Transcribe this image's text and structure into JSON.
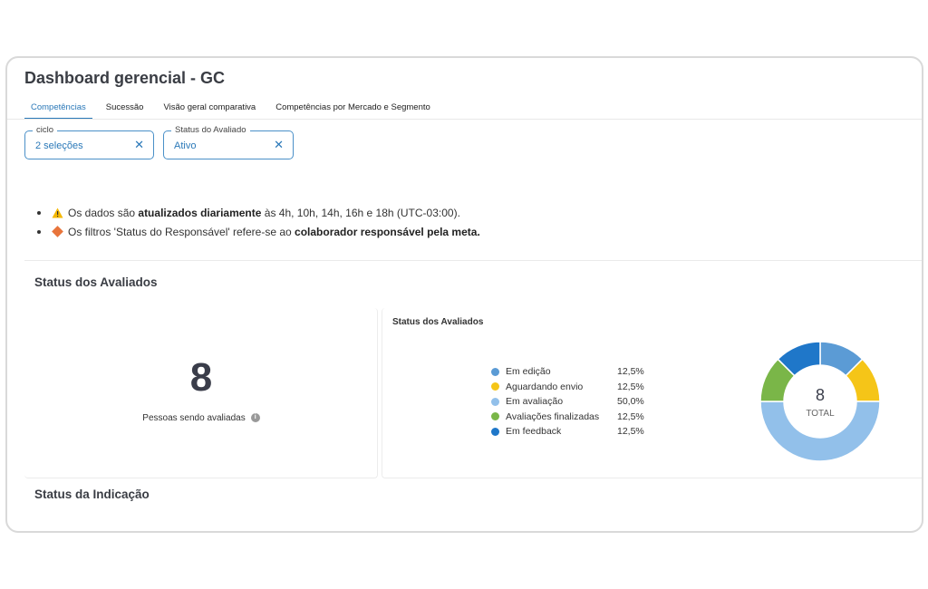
{
  "app": {
    "title": "Dashboard gerencial - GC"
  },
  "tabs": [
    {
      "label": "Competências",
      "active": true
    },
    {
      "label": "Sucessão",
      "active": false
    },
    {
      "label": "Visão geral comparativa",
      "active": false
    },
    {
      "label": "Competências por Mercado e Segmento",
      "active": false
    }
  ],
  "filters": [
    {
      "label": "ciclo",
      "value": "2 seleções",
      "clear_icon": "close-icon"
    },
    {
      "label": "Status do Avaliado",
      "value": "Ativo",
      "clear_icon": "close-icon"
    }
  ],
  "notices": [
    {
      "icon": "warning-icon",
      "parts": [
        {
          "text": "Os dados são ",
          "bold": false
        },
        {
          "text": "atualizados diariamente",
          "bold": true
        },
        {
          "text": " às 4h, 10h, 14h, 16h e 18h (UTC-03:00).",
          "bold": false
        }
      ]
    },
    {
      "icon": "diamond-icon",
      "parts": [
        {
          "text": "Os filtros 'Status do Responsável' refere-se ao ",
          "bold": false
        },
        {
          "text": "colaborador responsável pela meta.",
          "bold": true
        }
      ]
    }
  ],
  "sections": {
    "status_avaliados": "Status dos Avaliados",
    "status_indicacao": "Status da Indicação"
  },
  "kpi": {
    "value": "8",
    "label": "Pessoas sendo avaliadas",
    "info_icon": "info-icon"
  },
  "donut_chart": {
    "title": "Status dos Avaliados",
    "total_value": "8",
    "total_label": "TOTAL",
    "colors": {
      "Em edição": "#5b9bd5",
      "Aguardando envio": "#f5c518",
      "Em avaliação": "#92c0ea",
      "Avaliações finalizadas": "#7ab648",
      "Em feedback": "#1f77c9"
    }
  },
  "chart_data": {
    "type": "pie",
    "title": "Status dos Avaliados",
    "categories": [
      "Em edição",
      "Aguardando envio",
      "Em avaliação",
      "Avaliações finalizadas",
      "Em feedback"
    ],
    "values": [
      12.5,
      12.5,
      50.0,
      12.5,
      12.5
    ],
    "labels": [
      "12,5%",
      "12,5%",
      "50,0%",
      "12,5%",
      "12,5%"
    ],
    "legend": "left"
  }
}
